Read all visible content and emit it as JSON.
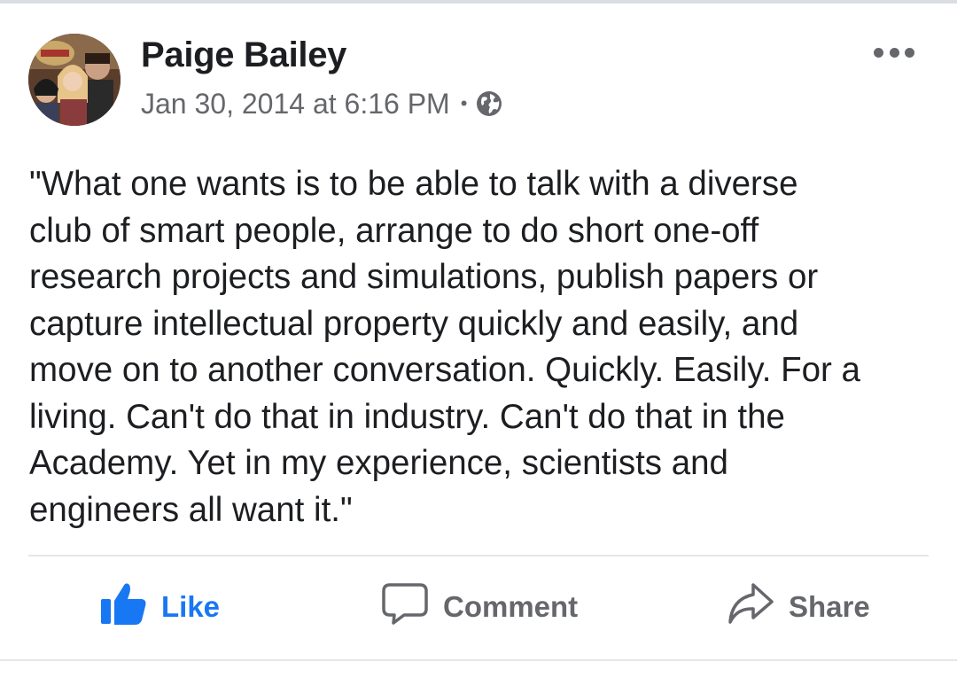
{
  "post": {
    "author": "Paige Bailey",
    "timestamp": "Jan 30, 2014 at 6:16 PM",
    "separator": "•",
    "privacy_icon": "globe-icon",
    "menu_icon": "more-options-icon",
    "text": "\"What one wants is to be able to talk with a diverse\nclub of smart people, arrange to do short one-off\nresearch projects and simulations, publish papers or\ncapture intellectual property quickly and easily, and\nmove on to another conversation. Quickly. Easily. For a\nliving. Can't do that in industry. Can't do that in the\nAcademy. Yet in my experience, scientists and\nengineers all want it.\""
  },
  "actions": {
    "like": {
      "label": "Like",
      "icon": "thumbs-up-icon",
      "active": true
    },
    "comment": {
      "label": "Comment",
      "icon": "comment-bubble-icon"
    },
    "share": {
      "label": "Share",
      "icon": "share-arrow-icon"
    }
  },
  "colors": {
    "text_primary": "#1c1e21",
    "text_secondary": "#65676b",
    "accent_blue": "#1877f2",
    "divider": "#e4e6eb"
  }
}
